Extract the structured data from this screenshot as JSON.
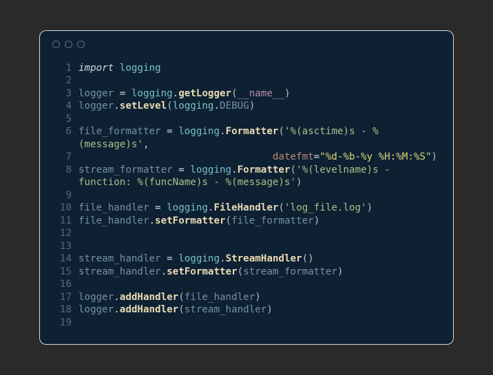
{
  "code": {
    "lines": [
      {
        "n": "1",
        "tokens": [
          [
            "kw",
            "import"
          ],
          [
            "plain",
            " "
          ],
          [
            "mod",
            "logging"
          ]
        ]
      },
      {
        "n": "2",
        "tokens": []
      },
      {
        "n": "3",
        "tokens": [
          [
            "var",
            "logger"
          ],
          [
            "op",
            " = "
          ],
          [
            "mod",
            "logging"
          ],
          [
            "plain",
            "."
          ],
          [
            "call",
            "getLogger"
          ],
          [
            "paren",
            "("
          ],
          [
            "dunder",
            "__name__"
          ],
          [
            "paren",
            ")"
          ]
        ]
      },
      {
        "n": "4",
        "tokens": [
          [
            "var",
            "logger"
          ],
          [
            "plain",
            "."
          ],
          [
            "call",
            "setLevel"
          ],
          [
            "paren",
            "("
          ],
          [
            "mod",
            "logging"
          ],
          [
            "plain",
            "."
          ],
          [
            "attr",
            "DEBUG"
          ],
          [
            "paren",
            ")"
          ]
        ]
      },
      {
        "n": "5",
        "tokens": []
      },
      {
        "n": "6",
        "tokens": [
          [
            "var",
            "file_formatter"
          ],
          [
            "op",
            " = "
          ],
          [
            "mod",
            "logging"
          ],
          [
            "plain",
            "."
          ],
          [
            "call",
            "Formatter"
          ],
          [
            "paren",
            "("
          ],
          [
            "str",
            "'%(asctime)s - %(message)s'"
          ],
          [
            "plain",
            ","
          ]
        ]
      },
      {
        "n": "7",
        "tokens": [
          [
            "plain",
            "                                 "
          ],
          [
            "param",
            "datefmt"
          ],
          [
            "op",
            "="
          ],
          [
            "strb",
            "\"%d-%b-%y %H:%M:%S\""
          ],
          [
            "paren",
            ")"
          ]
        ]
      },
      {
        "n": "8",
        "tokens": [
          [
            "var",
            "stream_formatter"
          ],
          [
            "op",
            " = "
          ],
          [
            "mod",
            "logging"
          ],
          [
            "plain",
            "."
          ],
          [
            "call",
            "Formatter"
          ],
          [
            "paren",
            "("
          ],
          [
            "str",
            "'%(levelname)s - function: %(funcName)s - %(message)s'"
          ],
          [
            "paren",
            ")"
          ]
        ]
      },
      {
        "n": "9",
        "tokens": []
      },
      {
        "n": "10",
        "tokens": [
          [
            "var",
            "file_handler"
          ],
          [
            "op",
            " = "
          ],
          [
            "mod",
            "logging"
          ],
          [
            "plain",
            "."
          ],
          [
            "call",
            "FileHandler"
          ],
          [
            "paren",
            "("
          ],
          [
            "str",
            "'log_file.log'"
          ],
          [
            "paren",
            ")"
          ]
        ]
      },
      {
        "n": "11",
        "tokens": [
          [
            "var",
            "file_handler"
          ],
          [
            "plain",
            "."
          ],
          [
            "call",
            "setFormatter"
          ],
          [
            "paren",
            "("
          ],
          [
            "var",
            "file_formatter"
          ],
          [
            "paren",
            ")"
          ]
        ]
      },
      {
        "n": "12",
        "tokens": []
      },
      {
        "n": "13",
        "tokens": []
      },
      {
        "n": "14",
        "tokens": [
          [
            "var",
            "stream_handler"
          ],
          [
            "op",
            " = "
          ],
          [
            "mod",
            "logging"
          ],
          [
            "plain",
            "."
          ],
          [
            "call",
            "StreamHandler"
          ],
          [
            "paren",
            "()"
          ]
        ]
      },
      {
        "n": "15",
        "tokens": [
          [
            "var",
            "stream_handler"
          ],
          [
            "plain",
            "."
          ],
          [
            "call",
            "setFormatter"
          ],
          [
            "paren",
            "("
          ],
          [
            "var",
            "stream_formatter"
          ],
          [
            "paren",
            ")"
          ]
        ]
      },
      {
        "n": "16",
        "tokens": []
      },
      {
        "n": "17",
        "tokens": [
          [
            "var",
            "logger"
          ],
          [
            "plain",
            "."
          ],
          [
            "call",
            "addHandler"
          ],
          [
            "paren",
            "("
          ],
          [
            "var",
            "file_handler"
          ],
          [
            "paren",
            ")"
          ]
        ]
      },
      {
        "n": "18",
        "tokens": [
          [
            "var",
            "logger"
          ],
          [
            "plain",
            "."
          ],
          [
            "call",
            "addHandler"
          ],
          [
            "paren",
            "("
          ],
          [
            "var",
            "stream_handler"
          ],
          [
            "paren",
            ")"
          ]
        ]
      },
      {
        "n": "19",
        "tokens": []
      }
    ]
  }
}
